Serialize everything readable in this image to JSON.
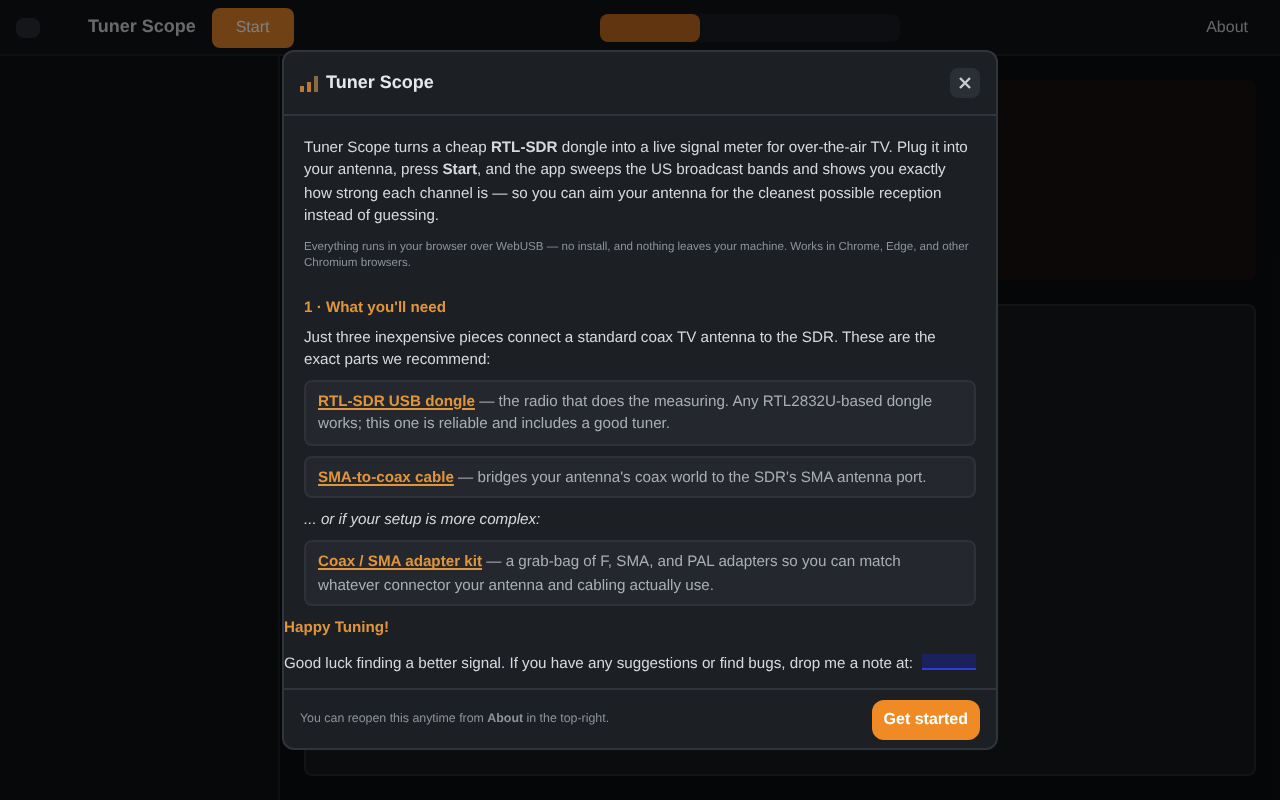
{
  "app": {
    "title": "Tuner Scope",
    "start_button": "Start",
    "about_link": "About"
  },
  "dialog": {
    "title": "Tuner Scope",
    "intro": "Tuner Scope turns a cheap **RTL-SDR** dongle into a live signal meter for over-the-air TV. Plug it into your antenna, press **Start**, and the app sweeps the US broadcast bands and shows you exactly how strong each channel is — so you can aim your antenna for the cleanest possible reception instead of guessing.",
    "note": "Everything runs in your browser over WebUSB — no install, and nothing leaves your machine. Works in Chrome, Edge, and other Chromium browsers.",
    "section_heading": "1 · What you'll need",
    "section_text": "Just three inexpensive pieces connect a standard coax TV antenna to the SDR. These are the exact parts we recommend:",
    "parts": [
      {
        "link": "RTL-SDR USB dongle",
        "text": " — the radio that does the measuring. Any RTL2832U-based dongle works; this one is reliable and includes a good tuner."
      },
      {
        "link": "SMA-to-coax cable",
        "text": " — bridges your antenna's coax world to the SDR's SMA antenna port."
      }
    ],
    "alt_heading": "... or if your setup is more complex:",
    "alt_parts": [
      {
        "link": "Coax / SMA adapter kit",
        "text": " — a grab-bag of F, SMA, and PAL adapters so you can match whatever connector your antenna and cabling actually use."
      }
    ],
    "closing_heading": "Happy Tuning!",
    "closing_text": "Good luck finding a better signal. If you have any suggestions or find bugs, drop me a note at:",
    "footer_note": "You can reopen this anytime from **About** in the top-right.",
    "primary_button": "Get started"
  }
}
